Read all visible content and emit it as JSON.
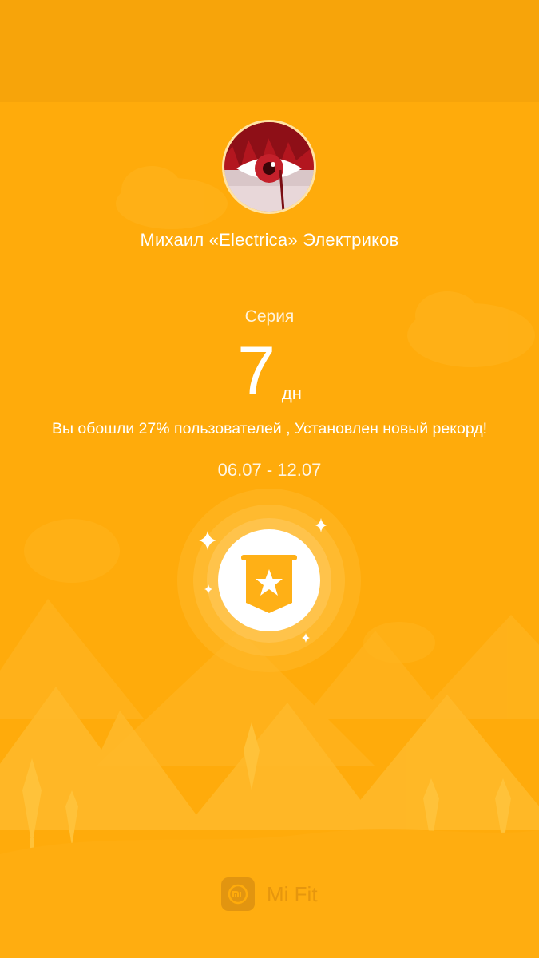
{
  "profile": {
    "name": "Михаил «Electrica» Электриков"
  },
  "streak": {
    "label": "Серия",
    "value": "7",
    "unit": "дн"
  },
  "result_text": "Вы обошли 27% пользователей , Установлен новый рекорд!",
  "date_range": "06.07 - 12.07",
  "brand": {
    "icon": "mi-logo-icon",
    "name": "Mi Fit"
  },
  "colors": {
    "background": "#ffab0b",
    "accent": "#ffffff",
    "badge": "#ffb016"
  }
}
